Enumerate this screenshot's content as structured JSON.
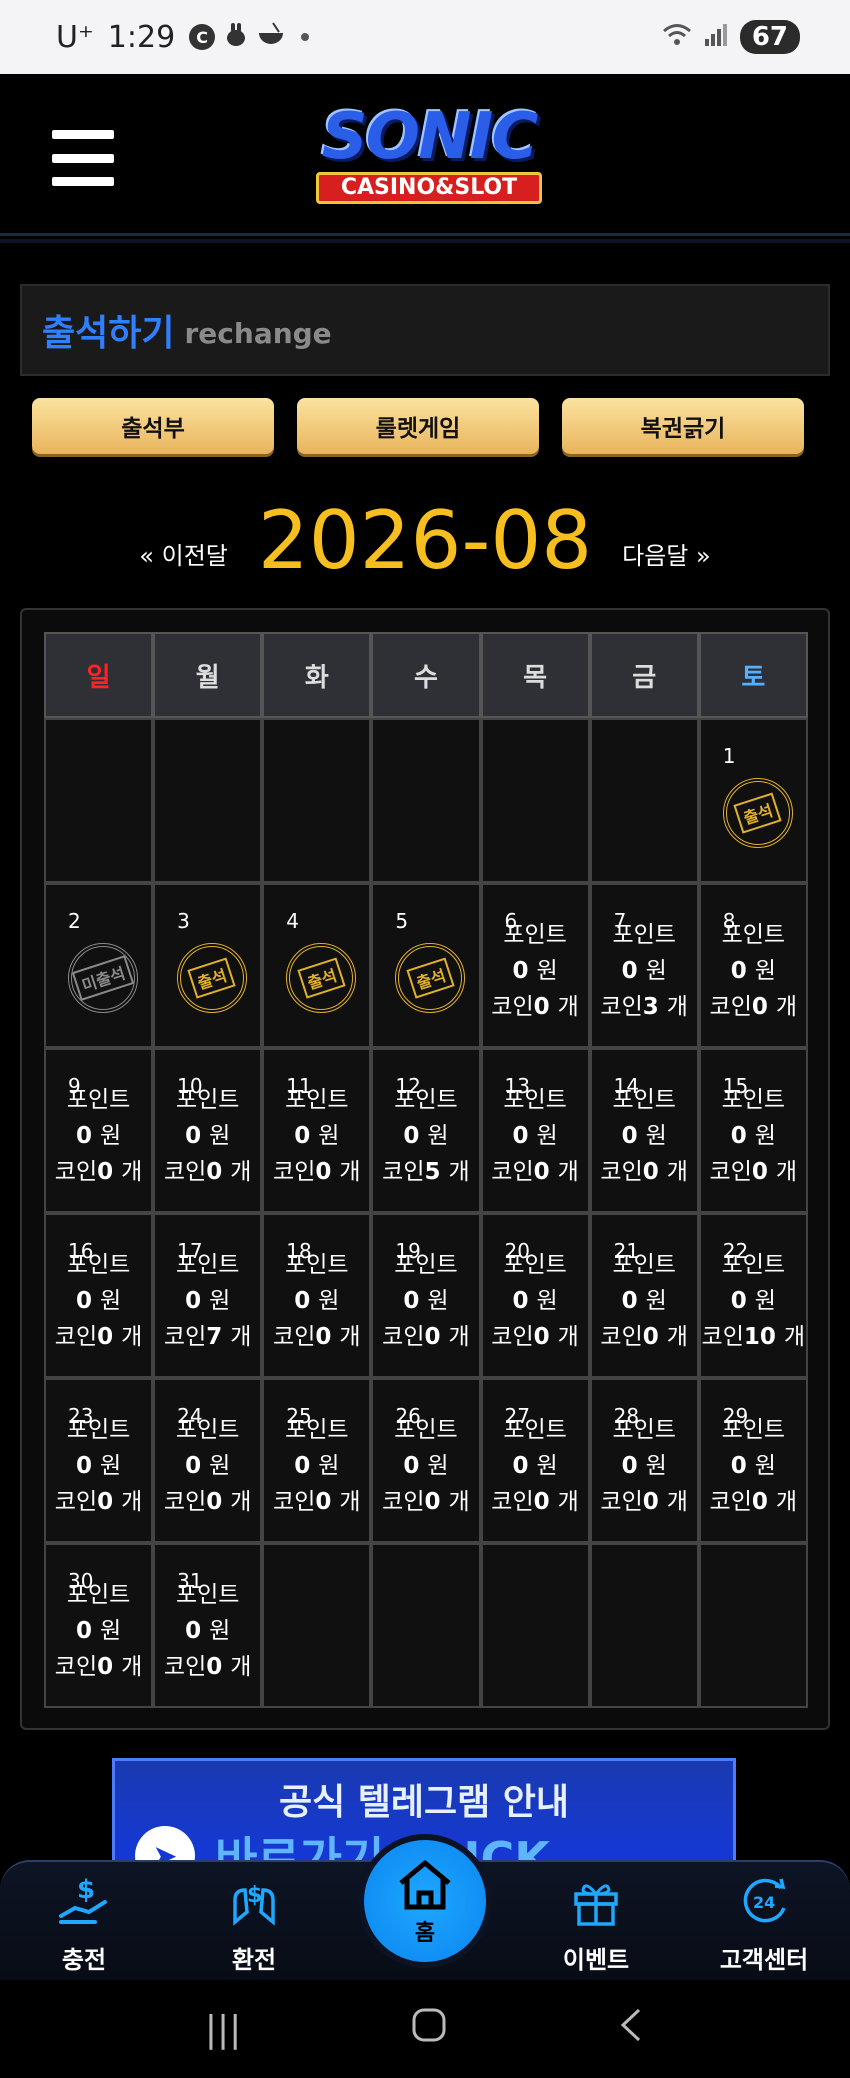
{
  "status_bar": {
    "carrier": "U⁺",
    "time": "1:29",
    "c_badge": "C",
    "battery": "67"
  },
  "header": {
    "logo_main": "SONIC",
    "logo_sub": "CASINO&SLOT"
  },
  "title": {
    "main": "출석하기",
    "sub": "rechange"
  },
  "buttons": {
    "attendance": "출석부",
    "roulette": "룰렛게임",
    "lottery": "복권긁기"
  },
  "month_nav": {
    "prev": "« 이전달",
    "current": "2026-08",
    "next": "다음달 »"
  },
  "calendar": {
    "weekdays": [
      "일",
      "월",
      "화",
      "수",
      "목",
      "금",
      "토"
    ],
    "point_label": "포인트",
    "won_unit": "원",
    "coin_label": "코인",
    "coin_unit": "개",
    "stamp_attended": "출석",
    "stamp_missed": "미출석",
    "days": [
      {
        "day": "1",
        "stamp": "attended"
      },
      {
        "day": "2",
        "stamp": "missed"
      },
      {
        "day": "3",
        "stamp": "attended"
      },
      {
        "day": "4",
        "stamp": "attended"
      },
      {
        "day": "5",
        "stamp": "attended"
      },
      {
        "day": "6",
        "points": "0",
        "coins": "0"
      },
      {
        "day": "7",
        "points": "0",
        "coins": "3"
      },
      {
        "day": "8",
        "points": "0",
        "coins": "0"
      },
      {
        "day": "9",
        "points": "0",
        "coins": "0"
      },
      {
        "day": "10",
        "points": "0",
        "coins": "0"
      },
      {
        "day": "11",
        "points": "0",
        "coins": "0"
      },
      {
        "day": "12",
        "points": "0",
        "coins": "5"
      },
      {
        "day": "13",
        "points": "0",
        "coins": "0"
      },
      {
        "day": "14",
        "points": "0",
        "coins": "0"
      },
      {
        "day": "15",
        "points": "0",
        "coins": "0"
      },
      {
        "day": "16",
        "points": "0",
        "coins": "0"
      },
      {
        "day": "17",
        "points": "0",
        "coins": "7"
      },
      {
        "day": "18",
        "points": "0",
        "coins": "0"
      },
      {
        "day": "19",
        "points": "0",
        "coins": "0"
      },
      {
        "day": "20",
        "points": "0",
        "coins": "0"
      },
      {
        "day": "21",
        "points": "0",
        "coins": "0"
      },
      {
        "day": "22",
        "points": "0",
        "coins": "10"
      },
      {
        "day": "23",
        "points": "0",
        "coins": "0"
      },
      {
        "day": "24",
        "points": "0",
        "coins": "0"
      },
      {
        "day": "25",
        "points": "0",
        "coins": "0"
      },
      {
        "day": "26",
        "points": "0",
        "coins": "0"
      },
      {
        "day": "27",
        "points": "0",
        "coins": "0"
      },
      {
        "day": "28",
        "points": "0",
        "coins": "0"
      },
      {
        "day": "29",
        "points": "0",
        "coins": "0"
      },
      {
        "day": "30",
        "points": "0",
        "coins": "0"
      },
      {
        "day": "31",
        "points": "0",
        "coins": "0"
      }
    ]
  },
  "telegram_banner": {
    "line1": "공식 텔레그램 안내",
    "line2": "바로가기 CLICK"
  },
  "bottom_nav": {
    "charge": "충전",
    "exchange": "환전",
    "home": "홈",
    "event": "이벤트",
    "support": "고객센터"
  },
  "colors": {
    "accent_blue": "#2f7fff",
    "month_gold": "#f6be1e",
    "sunday_red": "#ff2424",
    "saturday_blue": "#54b1ff",
    "stamp_gold": "#e2b12a"
  }
}
